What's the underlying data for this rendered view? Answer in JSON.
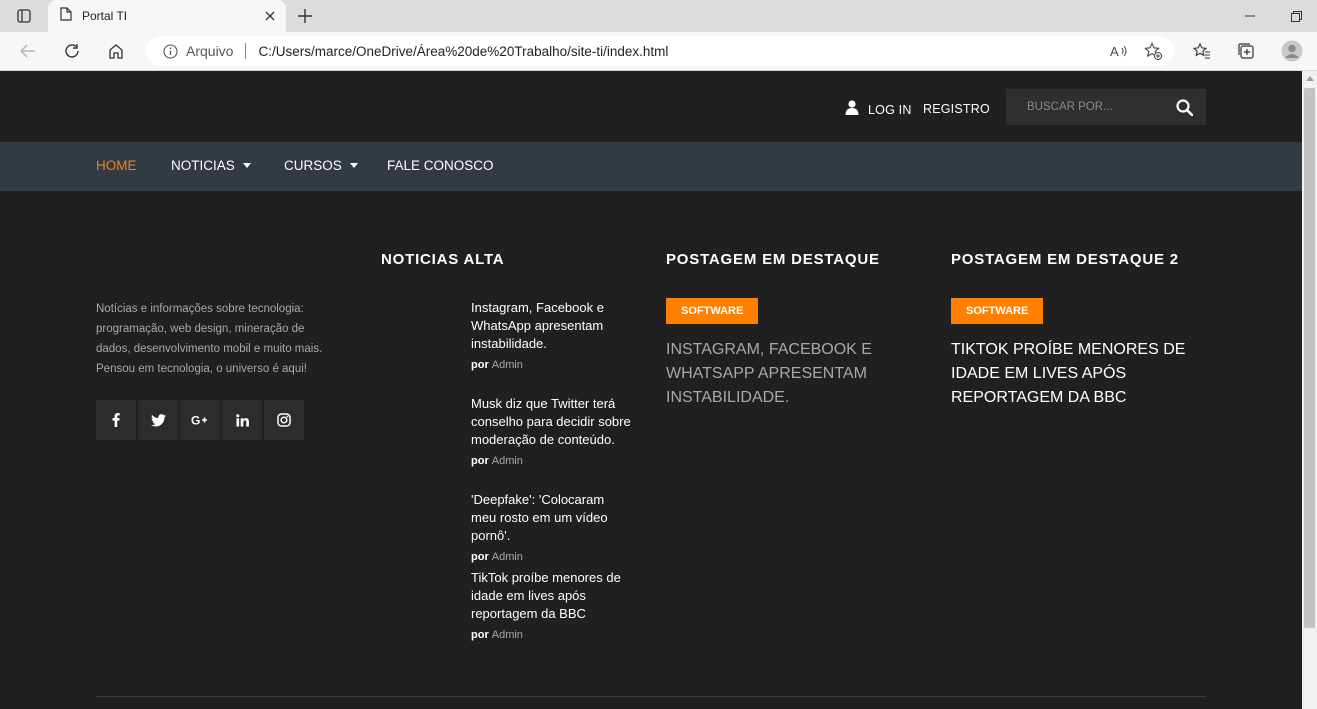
{
  "browser": {
    "tab_title": "Portal TI",
    "address_label": "Arquivo",
    "url": "C:/Users/marce/OneDrive/Área%20de%20Trabalho/site-ti/index.html"
  },
  "header": {
    "login_label": "LOG IN",
    "register_label": "REGISTRO",
    "search_placeholder": "BUSCAR POR..."
  },
  "nav": {
    "items": [
      {
        "label": "HOME",
        "active": true,
        "dropdown": false
      },
      {
        "label": "NOTICIAS",
        "active": false,
        "dropdown": true
      },
      {
        "label": "CURSOS",
        "active": false,
        "dropdown": true
      },
      {
        "label": "FALE CONOSCO",
        "active": false,
        "dropdown": false
      }
    ]
  },
  "about": {
    "text": "Notícias e informações sobre tecnologia: programação, web design, mineração de dados, desenvolvimento mobil e muito mais. Pensou em tecnologia, o universo é aqui!",
    "socials": [
      "facebook-icon",
      "twitter-icon",
      "google-plus-icon",
      "linkedin-icon",
      "instagram-icon"
    ]
  },
  "news": {
    "title": "NOTICIAS ALTA",
    "by_label": "por",
    "items": [
      {
        "title": "Instagram, Facebook e WhatsApp apresentam instabilidade.",
        "author": "Admin"
      },
      {
        "title": "Musk diz que Twitter terá conselho para decidir sobre moderação de conteúdo.",
        "author": "Admin"
      },
      {
        "title": "'Deepfake': 'Colocaram meu rosto em um vídeo pornô'.",
        "author": "Admin"
      },
      {
        "title": "TikTok proíbe menores de idade em lives após reportagem da BBC",
        "author": "Admin"
      }
    ]
  },
  "featured": {
    "title": "POSTAGEM EM DESTAQUE",
    "badge": "SOFTWARE",
    "post_title": "INSTAGRAM, FACEBOOK E WHATSAPP APRESENTAM INSTABILIDADE."
  },
  "featured2": {
    "title": "POSTAGEM EM DESTAQUE 2",
    "badge": "SOFTWARE",
    "post_title": "TIKTOK PROÍBE MENORES DE IDADE EM LIVES APÓS REPORTAGEM DA BBC"
  },
  "colors": {
    "accent": "#ff7f00",
    "nav_bg": "#343a42",
    "page_bg": "#202020"
  }
}
